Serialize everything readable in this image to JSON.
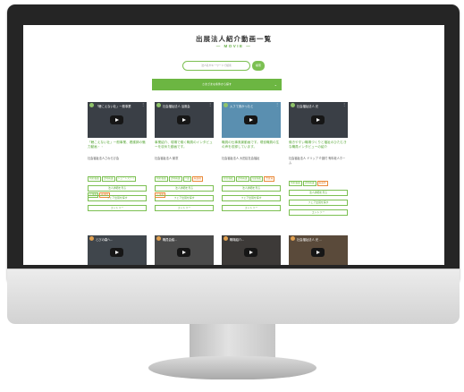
{
  "page": {
    "title": "出展法人紹介動画一覧",
    "subtitle": "— MOVIE —"
  },
  "search": {
    "placeholder": "法人名やキーワードで検索",
    "button": "検索"
  },
  "filter": {
    "label": "さまざまな条件から探す",
    "icon": "chevron-down-icon"
  },
  "cards": [
    {
      "video_title": "「聴こえない壮」一般事業",
      "title": "「聴こえない壮」一般事業、看護師の魅力動画・・",
      "org": "社会福祉法人さわらび会",
      "tags": [
        {
          "t": "特別養護",
          "c": "g"
        },
        {
          "t": "訪問看護",
          "c": "g"
        },
        {
          "t": "ショートステイ",
          "c": "g"
        },
        {
          "t": "介護職",
          "c": "g"
        },
        {
          "t": "看護師",
          "c": "o"
        }
      ]
    },
    {
      "video_title": "社会福祉法人 浴風会",
      "title": "事業紹介、現場で働く職員のインタビューを収めた動画です。",
      "org": "社会福祉法人 鶴童",
      "tags": [
        {
          "t": "特別養護",
          "c": "g"
        },
        {
          "t": "訪問看護",
          "c": "g"
        },
        {
          "t": "介護",
          "c": "g"
        },
        {
          "t": "看護職",
          "c": "o"
        },
        {
          "t": "介護職",
          "c": "o"
        }
      ]
    },
    {
      "video_title": "入フて良かったと",
      "title": "職員の仕事風景動画です。現役職員の生の声を収録しています。",
      "org": "社会福祉法人 大田区社会福祉",
      "tags": [
        {
          "t": "障害福祉",
          "c": "g"
        },
        {
          "t": "訪問看護",
          "c": "g"
        },
        {
          "t": "児童福祉",
          "c": "g"
        },
        {
          "t": "支援員",
          "c": "o"
        }
      ]
    },
    {
      "video_title": "社会福祉法人 光",
      "title": "働きやすい職場づくりと福祉のひたむきな職員インタビューの紹介",
      "org": "社会福祉法人 ドリップ 介護付 有料老人ホーム",
      "tags": [
        {
          "t": "特別養護",
          "c": "g"
        },
        {
          "t": "訪問看護",
          "c": "g"
        },
        {
          "t": "看護師",
          "c": "o"
        }
      ]
    }
  ],
  "buttons": {
    "details": "法人詳細を見る",
    "fair": "フェア出展を探す",
    "entry": "エントリー"
  },
  "row2": [
    {
      "video_title": "とびの森へ..."
    },
    {
      "video_title": "職員会議..."
    },
    {
      "video_title": "職場紹介..."
    },
    {
      "video_title": "社会福祉法人 光 ..."
    }
  ],
  "colors": {
    "accent": "#6cb642",
    "tag_orange": "#e98a3a"
  }
}
